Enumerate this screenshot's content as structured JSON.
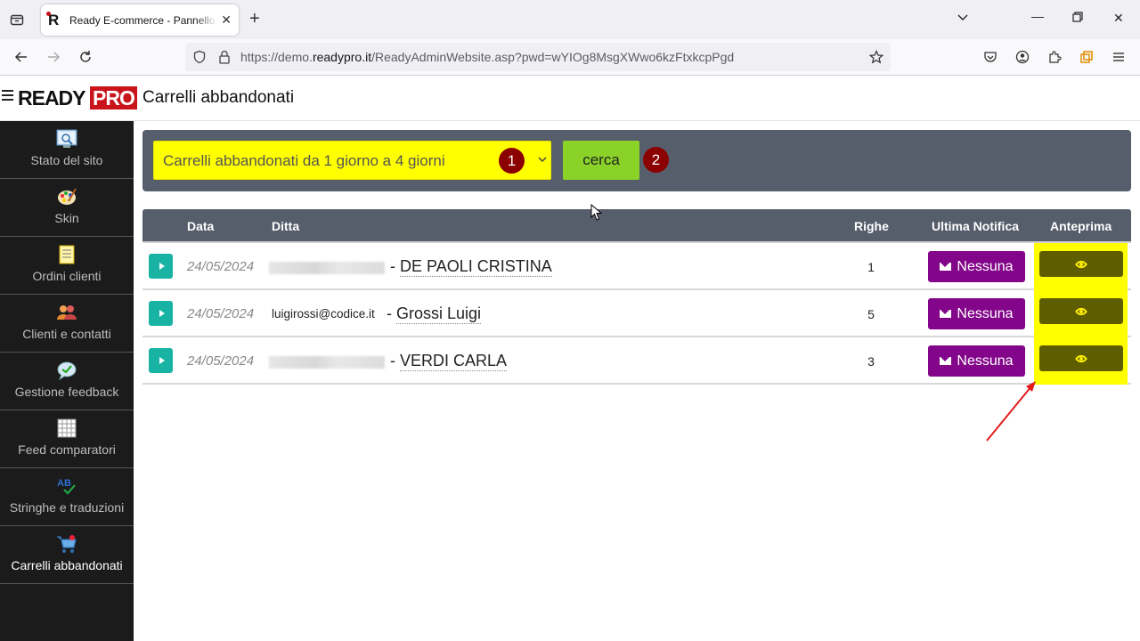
{
  "browser": {
    "tab_title": "Ready E-commerce - Pannello amministrazione",
    "url_prefix": "https://demo.",
    "url_domain": "readypro.it",
    "url_rest": "/ReadyAdminWebsite.asp?pwd=wYIOg8MsgXWwo6kzFtxkcpPgd"
  },
  "header": {
    "logo_ready": "READY",
    "logo_pro": "PRO",
    "page_title": "Carrelli abbandonati"
  },
  "sidebar": {
    "items": [
      {
        "label": "Stato del sito",
        "icon": "site-status-icon"
      },
      {
        "label": "Skin",
        "icon": "palette-icon"
      },
      {
        "label": "Ordini clienti",
        "icon": "orders-icon"
      },
      {
        "label": "Clienti e contatti",
        "icon": "contacts-icon"
      },
      {
        "label": "Gestione feedback",
        "icon": "feedback-icon"
      },
      {
        "label": "Feed comparatori",
        "icon": "feed-grid-icon"
      },
      {
        "label": "Stringhe e traduzioni",
        "icon": "translations-icon"
      },
      {
        "label": "Carrelli abbandonati",
        "icon": "cart-icon",
        "active": true
      }
    ]
  },
  "filter": {
    "selected": "Carrelli abbandonati da 1 giorno a 4 giorni",
    "search_label": "cerca",
    "badge1": "1",
    "badge2": "2"
  },
  "table": {
    "headers": {
      "data": "Data",
      "ditta": "Ditta",
      "righe": "Righe",
      "notifica": "Ultima Notifica",
      "anteprima": "Anteprima"
    },
    "rows": [
      {
        "date": "24/05/2024",
        "email": "",
        "sep": "-",
        "name": "DE PAOLI CRISTINA",
        "righe": "1",
        "notifica": "Nessuna"
      },
      {
        "date": "24/05/2024",
        "email": "luigirossi@codice.it",
        "sep": "-",
        "name": "Grossi Luigi",
        "righe": "5",
        "notifica": "Nessuna"
      },
      {
        "date": "24/05/2024",
        "email": "",
        "sep": "-",
        "name": "VERDI CARLA",
        "righe": "3",
        "notifica": "Nessuna"
      }
    ]
  },
  "colors": {
    "highlight": "#ffff00",
    "badge": "#8b0000",
    "notify": "#82058a",
    "search": "#8ad228",
    "expand": "#19b3a4"
  }
}
